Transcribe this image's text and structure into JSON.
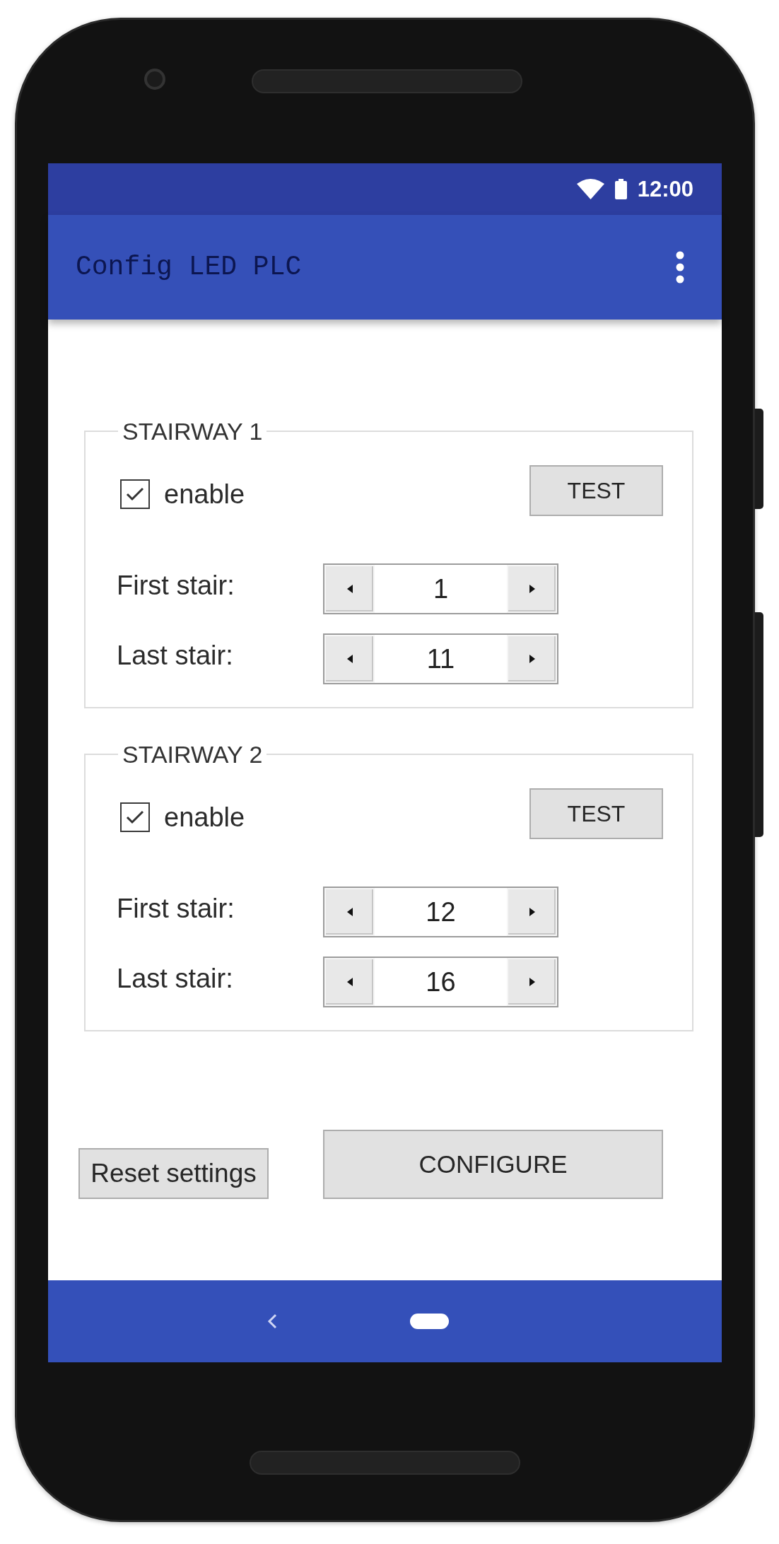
{
  "status_bar": {
    "time": "12:00"
  },
  "app_bar": {
    "title": "Config LED PLC"
  },
  "stairways": [
    {
      "title": "STAIRWAY 1",
      "checkbox": {
        "label": "enable",
        "checked": true
      },
      "test_button": "TEST",
      "fields": [
        {
          "label": "First stair:",
          "value": "1"
        },
        {
          "label": "Last stair:",
          "value": "11"
        }
      ]
    },
    {
      "title": "STAIRWAY 2",
      "checkbox": {
        "label": "enable",
        "checked": true
      },
      "test_button": "TEST",
      "fields": [
        {
          "label": "First stair:",
          "value": "12"
        },
        {
          "label": "Last stair:",
          "value": "16"
        }
      ]
    }
  ],
  "actions": {
    "reset_button": "Reset settings",
    "configure_button": "CONFIGURE"
  }
}
